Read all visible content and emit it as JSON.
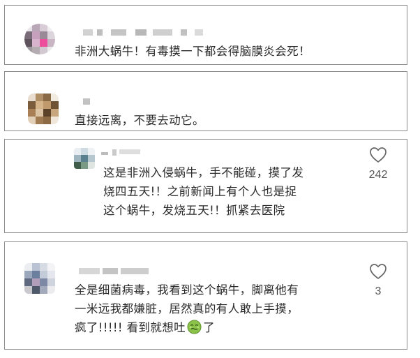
{
  "comments": [
    {
      "text_lines": [
        "非洲大蜗牛！有毒摸一下都会得脑膜炎会死！"
      ]
    },
    {
      "text_lines": [
        "直接远离，不要去动它。"
      ]
    },
    {
      "text_lines": [
        "这是非洲入侵蜗牛，手不能碰，摸了发",
        "烧四五天!！之前新闻上有个人也是捉",
        "这个蜗牛，发烧五天!！抓紧去医院"
      ],
      "likes": "242"
    },
    {
      "text_lines": [
        "全是细菌病毒，我看到这个蜗牛，脚离他有",
        "一米远我都嫌脏，居然真的有人敢上手摸，",
        "疯了!!!!!  看到就想吐"
      ],
      "text_suffix": "了",
      "likes": "3"
    }
  ],
  "icons": {
    "like": "heart-outline-icon",
    "emoji": "nauseated-face-emoji"
  },
  "colors": {
    "border": "#8a8a8a",
    "text": "#2a2a2a",
    "count": "#555555",
    "blur": "#d2d2d2"
  }
}
